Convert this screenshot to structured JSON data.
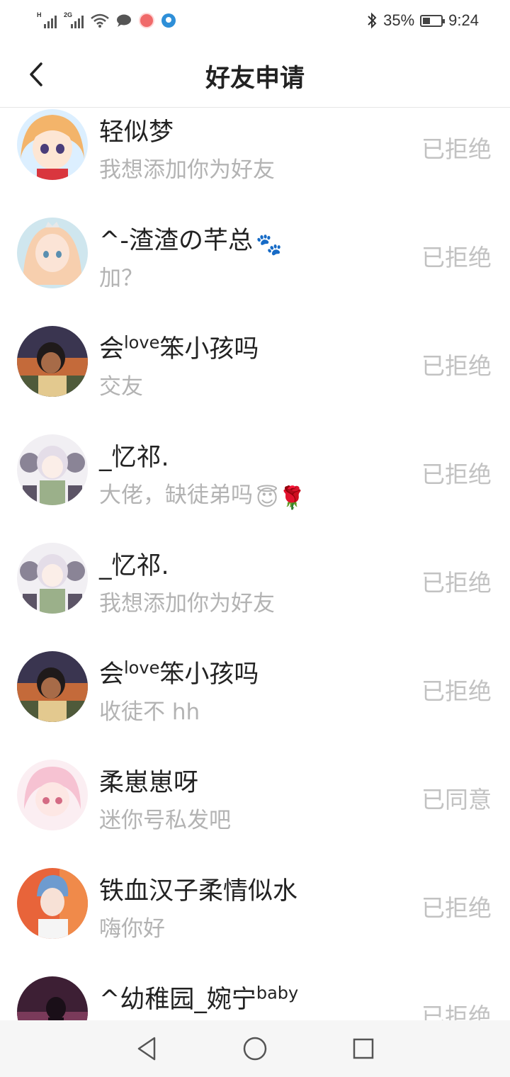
{
  "status_bar": {
    "signal1_tag": "H",
    "signal2_tag": "2G",
    "battery_percent": "35%",
    "time": "9:24",
    "icons": [
      "signal-icon",
      "signal-icon",
      "wifi-icon",
      "chat-bubble-icon",
      "app-notification-icon",
      "browser-icon",
      "bluetooth-icon",
      "battery-icon"
    ]
  },
  "header": {
    "title": "好友申请"
  },
  "requests": [
    {
      "name": "轻似梦",
      "message": "我想添加你为好友",
      "status": "已拒绝"
    },
    {
      "name": "^-渣渣の芊总",
      "name_emoji": "🐾",
      "message": "加？",
      "status": "已拒绝"
    },
    {
      "name": "会",
      "name_sup": "love",
      "name_tail": "笨小孩吗",
      "message": "交友",
      "status": "已拒绝"
    },
    {
      "name": "_忆祁.",
      "message": "大佬，缺徒弟吗",
      "message_emoji": "😇🌹",
      "status": "已拒绝"
    },
    {
      "name": "_忆祁.",
      "message": "我想添加你为好友",
      "status": "已拒绝"
    },
    {
      "name": "会",
      "name_sup": "love",
      "name_tail": "笨小孩吗",
      "message": "收徒不 hh",
      "status": "已拒绝"
    },
    {
      "name": "柔崽崽呀",
      "message": "迷你号私发吧",
      "status": "已同意"
    },
    {
      "name": "铁血汉子柔情似水",
      "message": "嗨你好",
      "status": "已拒绝"
    },
    {
      "name": "^幼稚园_婉宁",
      "name_sup": "baby",
      "message": "",
      "status": "已拒绝"
    }
  ],
  "nav_bar": {
    "icons": [
      "back-triangle-icon",
      "home-circle-icon",
      "recents-square-icon"
    ]
  }
}
